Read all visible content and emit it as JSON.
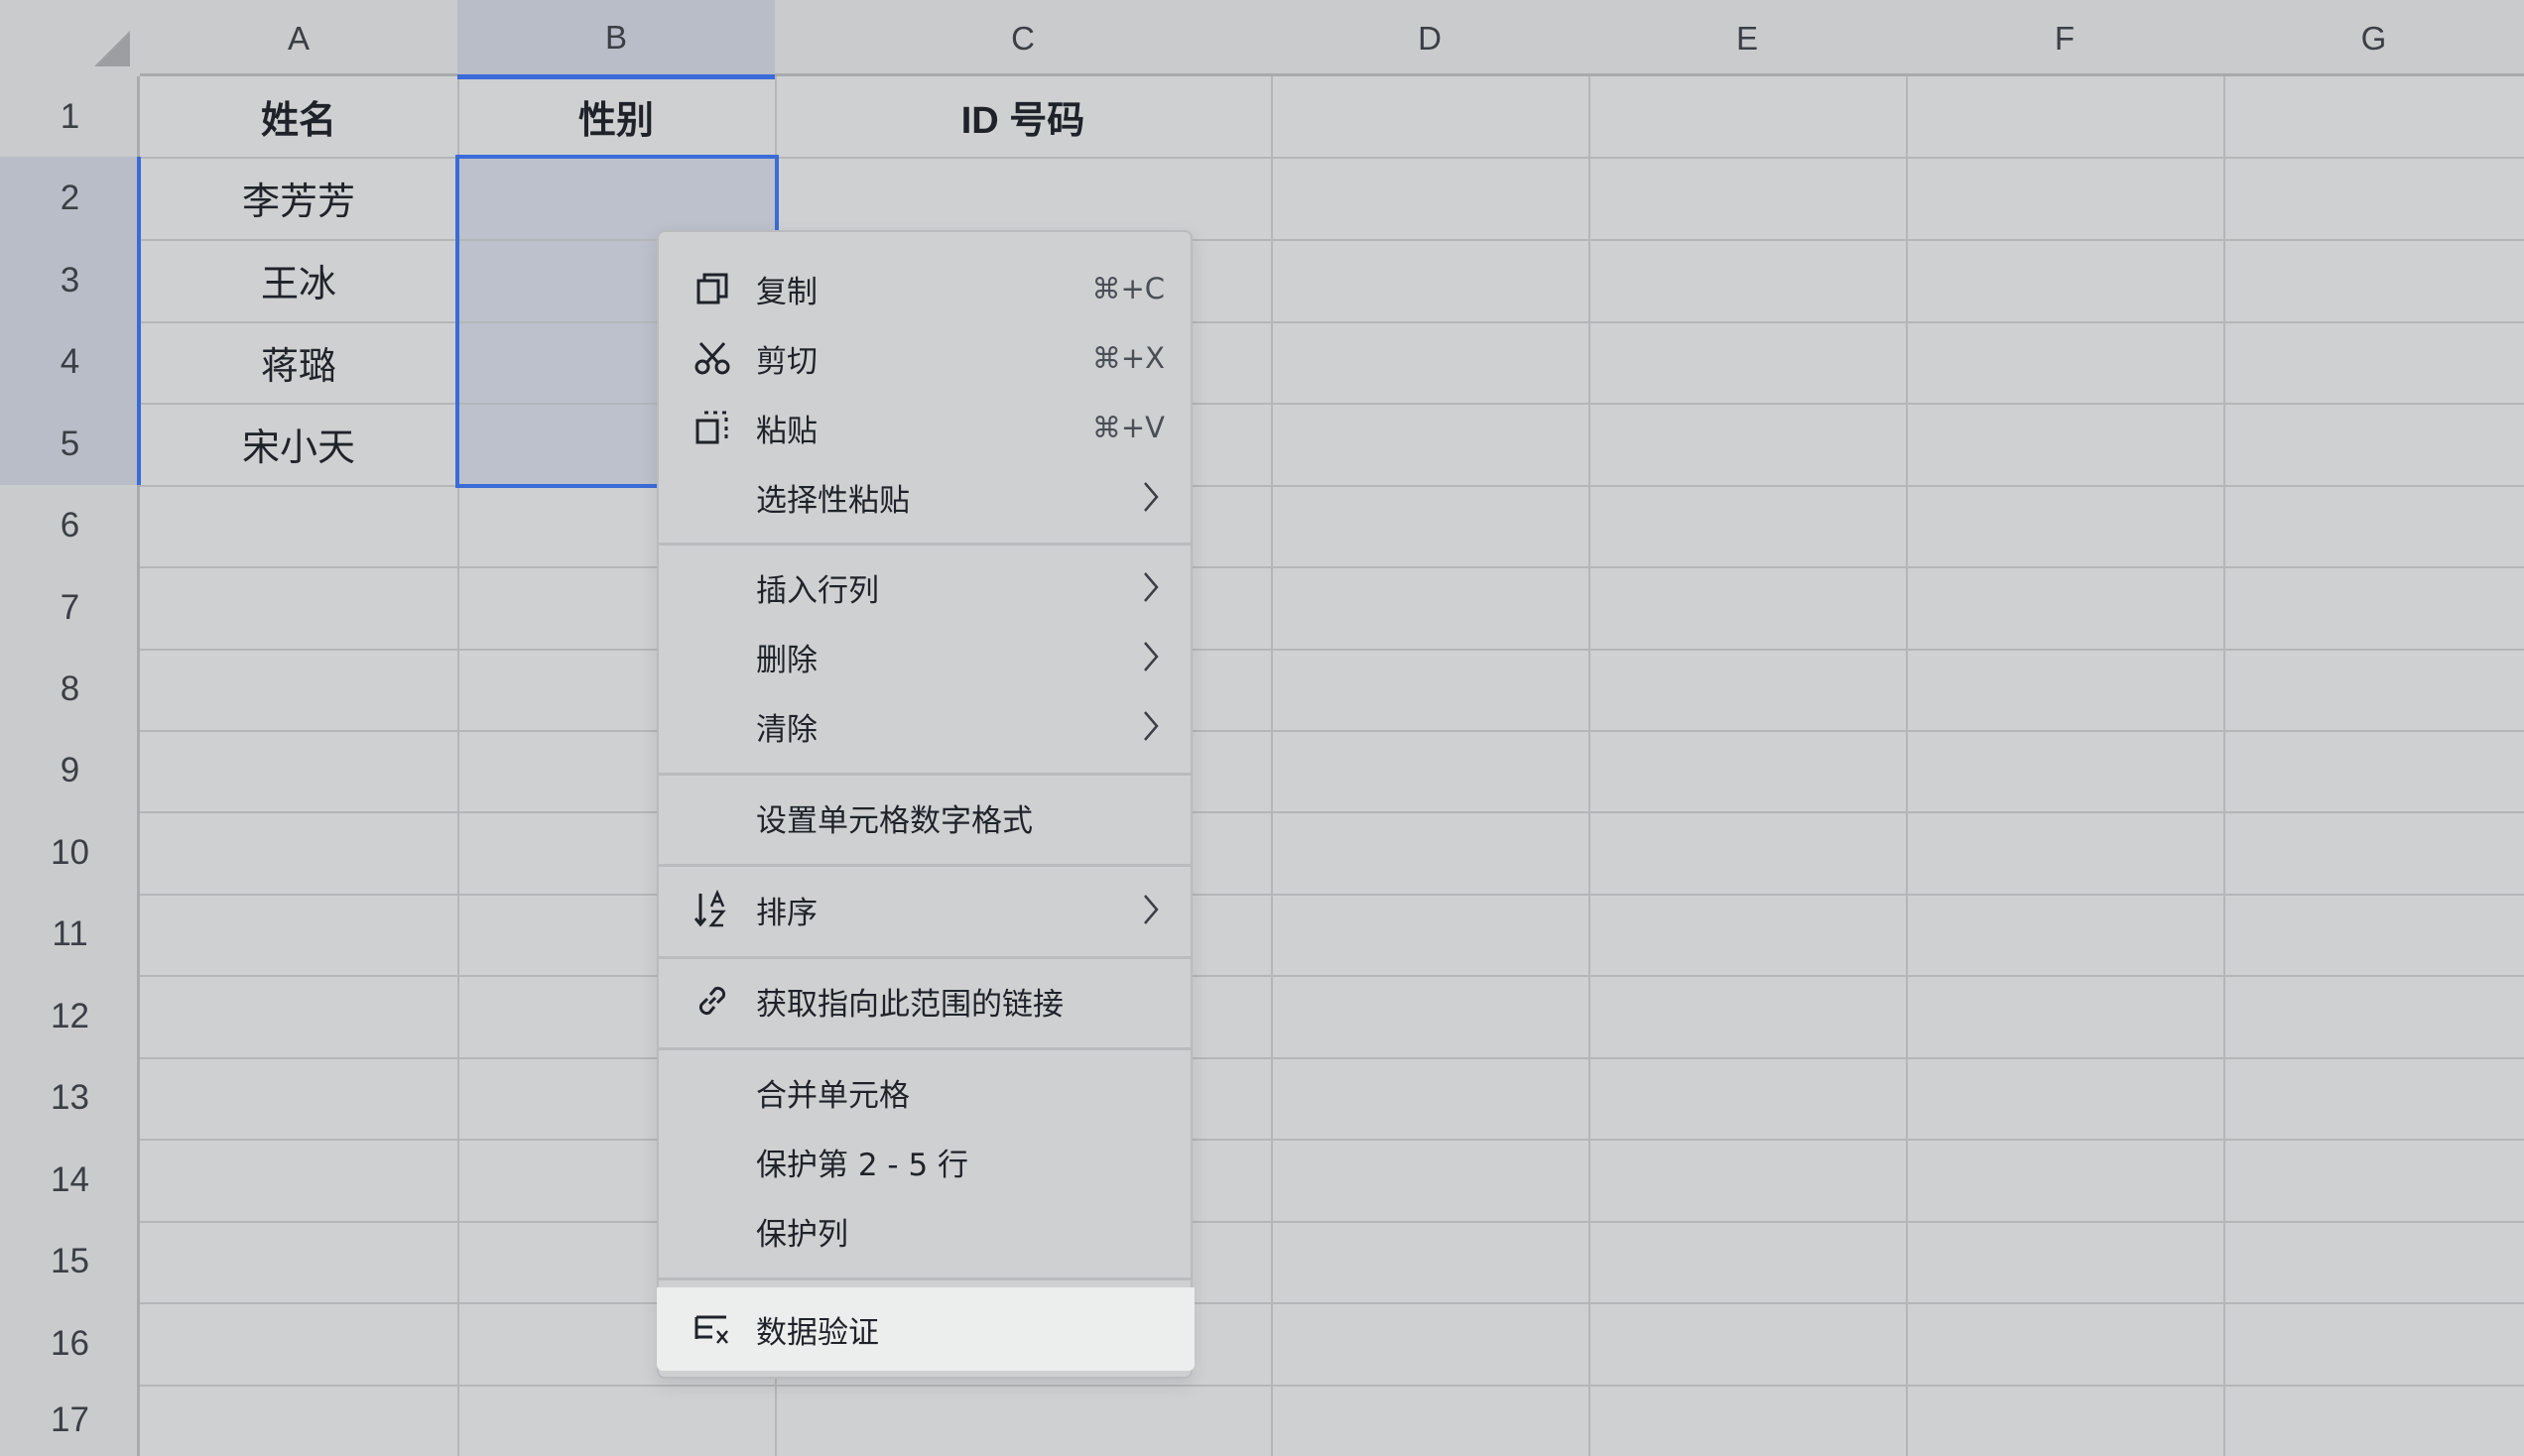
{
  "columns": [
    "A",
    "B",
    "C",
    "D",
    "E",
    "F",
    "G"
  ],
  "rows": [
    "1",
    "2",
    "3",
    "4",
    "5",
    "6",
    "7",
    "8",
    "9",
    "10",
    "11",
    "12",
    "13",
    "14",
    "15",
    "16",
    "17"
  ],
  "cells": {
    "A1": "姓名",
    "B1": "性别",
    "C1": "ID 号码",
    "A2": "李芳芳",
    "A3": "王冰",
    "A4": "蒋璐",
    "A5": "宋小天"
  },
  "context_menu": {
    "copy": {
      "label": "复制",
      "shortcut": "⌘+C",
      "icon": "copy-icon"
    },
    "cut": {
      "label": "剪切",
      "shortcut": "⌘+X",
      "icon": "scissors-icon"
    },
    "paste": {
      "label": "粘贴",
      "shortcut": "⌘+V",
      "icon": "paste-icon"
    },
    "paste_special": {
      "label": "选择性粘贴"
    },
    "insert": {
      "label": "插入行列"
    },
    "delete": {
      "label": "删除"
    },
    "clear": {
      "label": "清除"
    },
    "number_format": {
      "label": "设置单元格数字格式"
    },
    "sort": {
      "label": "排序",
      "icon": "sort-icon"
    },
    "link": {
      "label": "获取指向此范围的链接",
      "icon": "link-icon"
    },
    "merge": {
      "label": "合并单元格"
    },
    "protect_rows": {
      "label": "保护第 2 - 5 行"
    },
    "protect_col": {
      "label": "保护列"
    },
    "data_validation": {
      "label": "数据验证",
      "icon": "data-validation-icon"
    }
  },
  "colors": {
    "selection_border": "#3a6bd6",
    "selection_fill": "#bcc1cb",
    "highlight_item": "#eceded"
  }
}
